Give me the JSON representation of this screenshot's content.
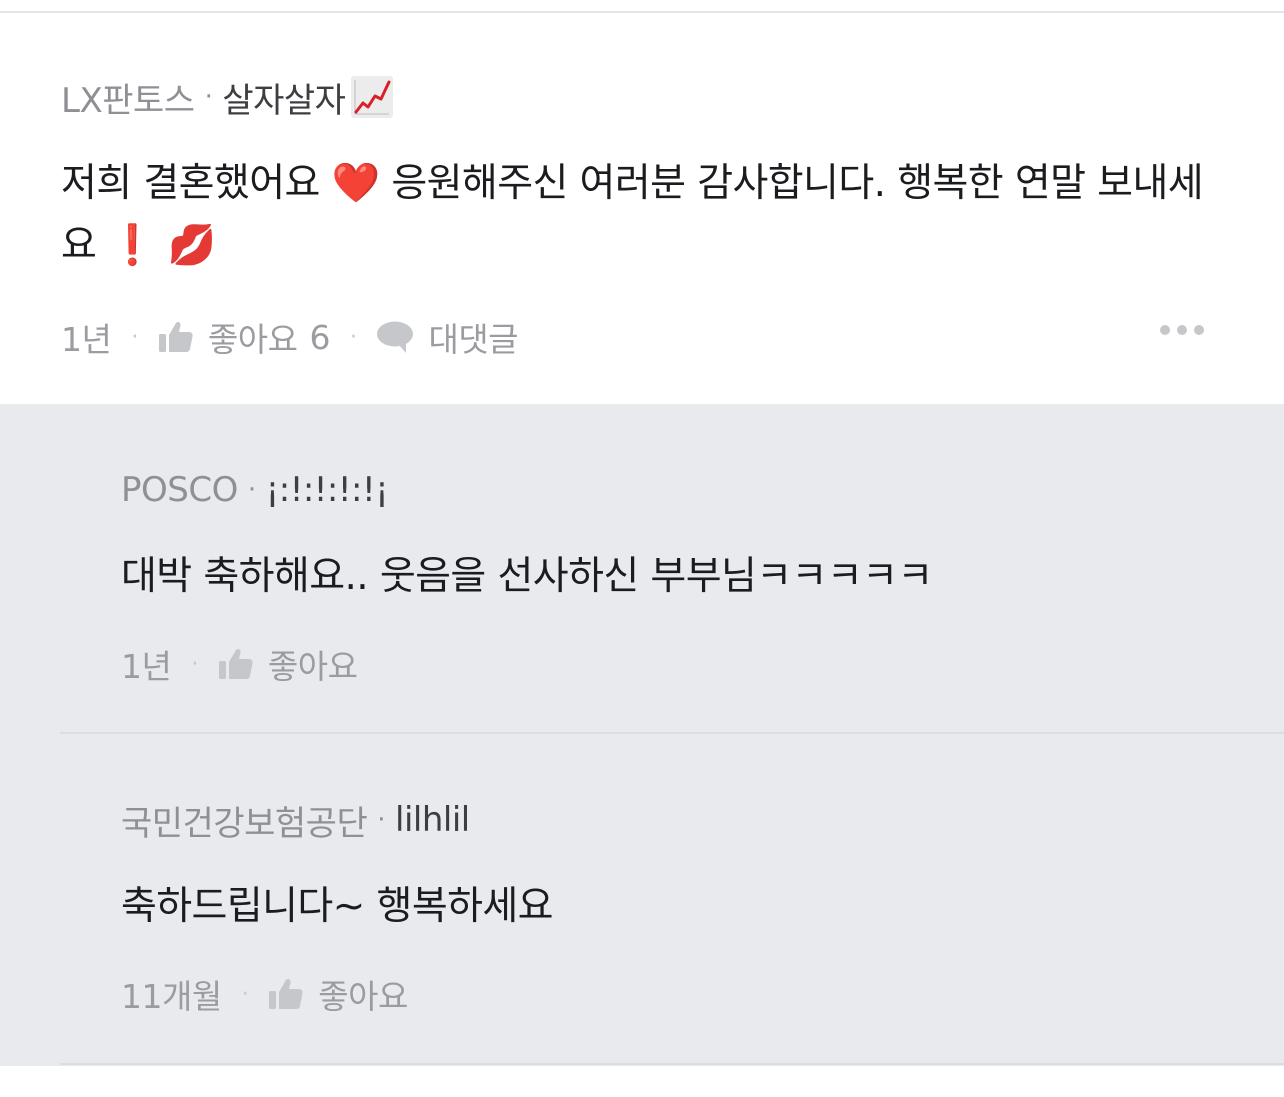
{
  "post": {
    "company": "LX판토스",
    "separator": "·",
    "nickname": "살자살자",
    "nickname_emoji": "chart-increasing-emoji",
    "body_text_1": "저희 결혼했어요",
    "heart": "❤️",
    "body_text_2": "응원해주신 여러분 감사합니다. 행복한 연말 보내세요",
    "exclamation": "❗",
    "kiss": "💋",
    "time": "1년",
    "like_label": "좋아요",
    "like_count": "6",
    "reply_label": "대댓글"
  },
  "replies": [
    {
      "company": "POSCO",
      "separator": "·",
      "nickname": "¡:!:!:!:!¡",
      "text": "대박 축하해요.. 웃음을 선사하신 부부님ㅋㅋㅋㅋㅋ",
      "time": "1년",
      "like_label": "좋아요"
    },
    {
      "company": "국민건강보험공단",
      "separator": "·",
      "nickname": "lilhlil",
      "text": "축하드립니다~ 행복하세요",
      "time": "11개월",
      "like_label": "좋아요"
    }
  ],
  "colors": {
    "background": "#ffffff",
    "reply_background": "#e9eaed",
    "text": "#1b1c1f",
    "muted": "#9a9ca1",
    "accent_red": "#e0202a"
  }
}
